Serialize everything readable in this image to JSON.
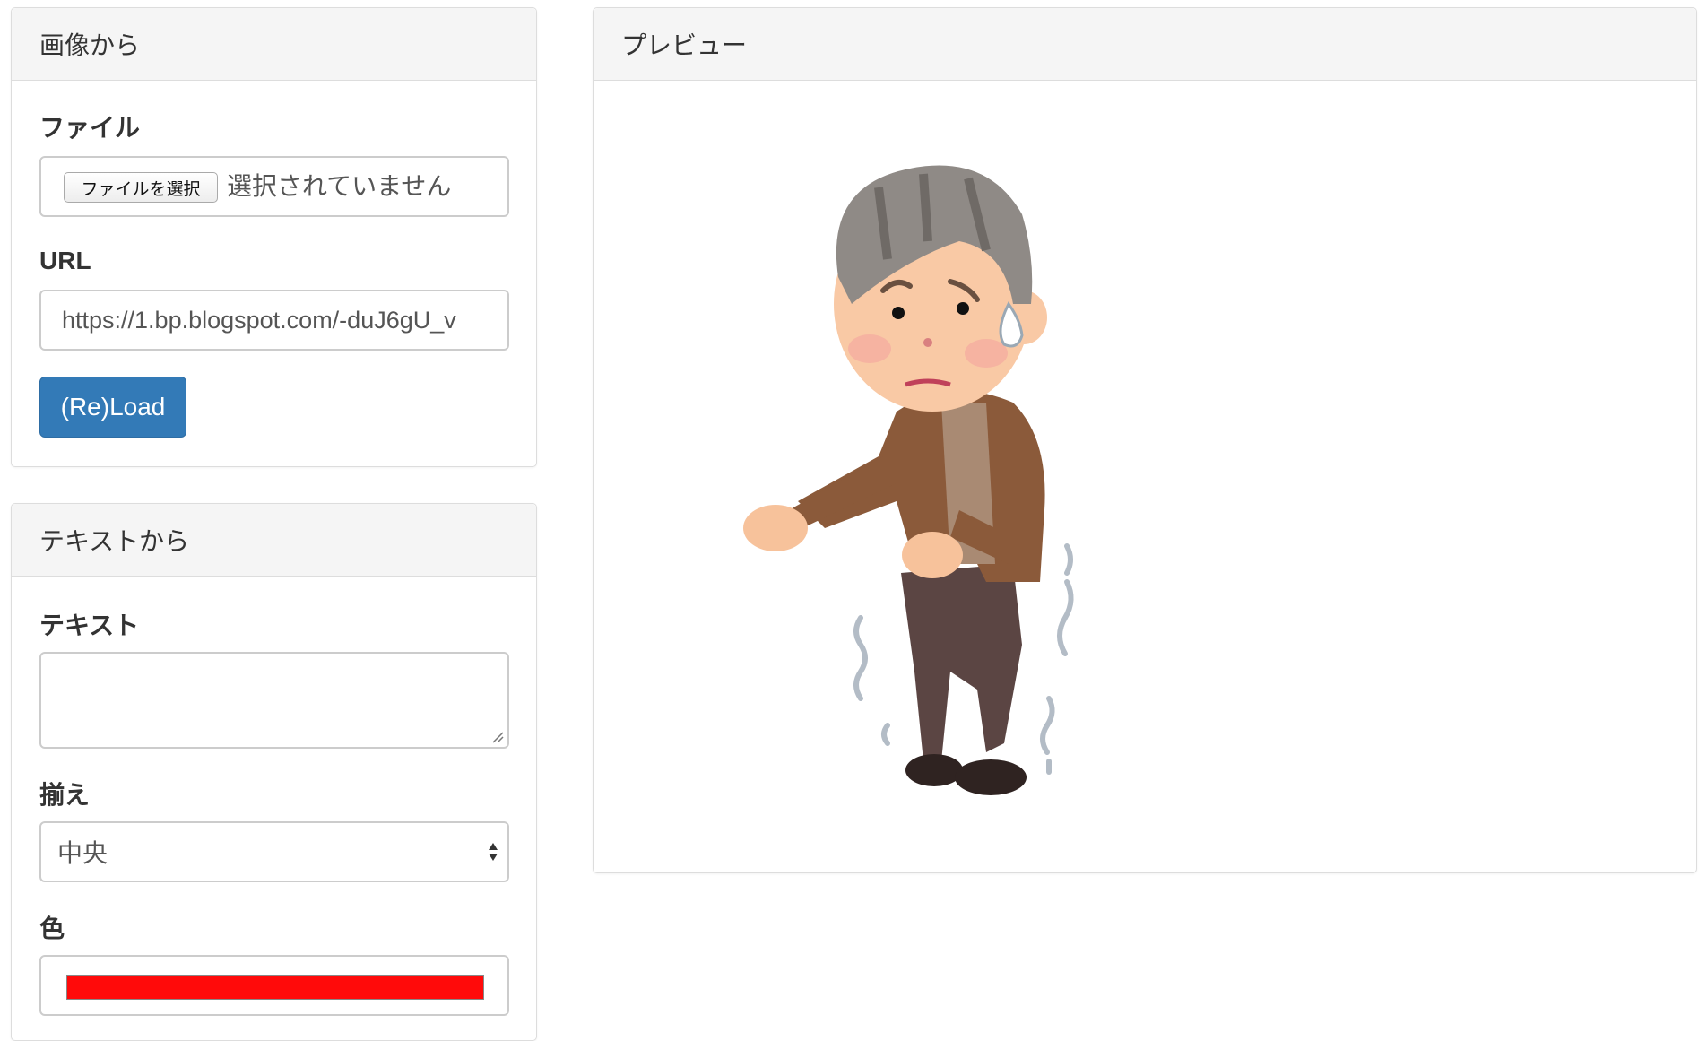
{
  "image_panel": {
    "title": "画像から",
    "file_label": "ファイル",
    "file_button": "ファイルを選択",
    "file_status": "選択されていません",
    "url_label": "URL",
    "url_value": "https://1.bp.blogspot.com/-duJ6gU_v",
    "reload_button": "(Re)Load"
  },
  "text_panel": {
    "title": "テキストから",
    "text_label": "テキスト",
    "text_value": "",
    "align_label": "揃え",
    "align_value": "中央",
    "color_label": "色",
    "color_value": "#ff0a0a"
  },
  "preview_panel": {
    "title": "プレビュー",
    "image_icon": "elderly-man-trembling-illustration"
  },
  "colors": {
    "primary": "#337ab7",
    "panel_heading_bg": "#f5f5f5",
    "border": "#dddddd"
  }
}
